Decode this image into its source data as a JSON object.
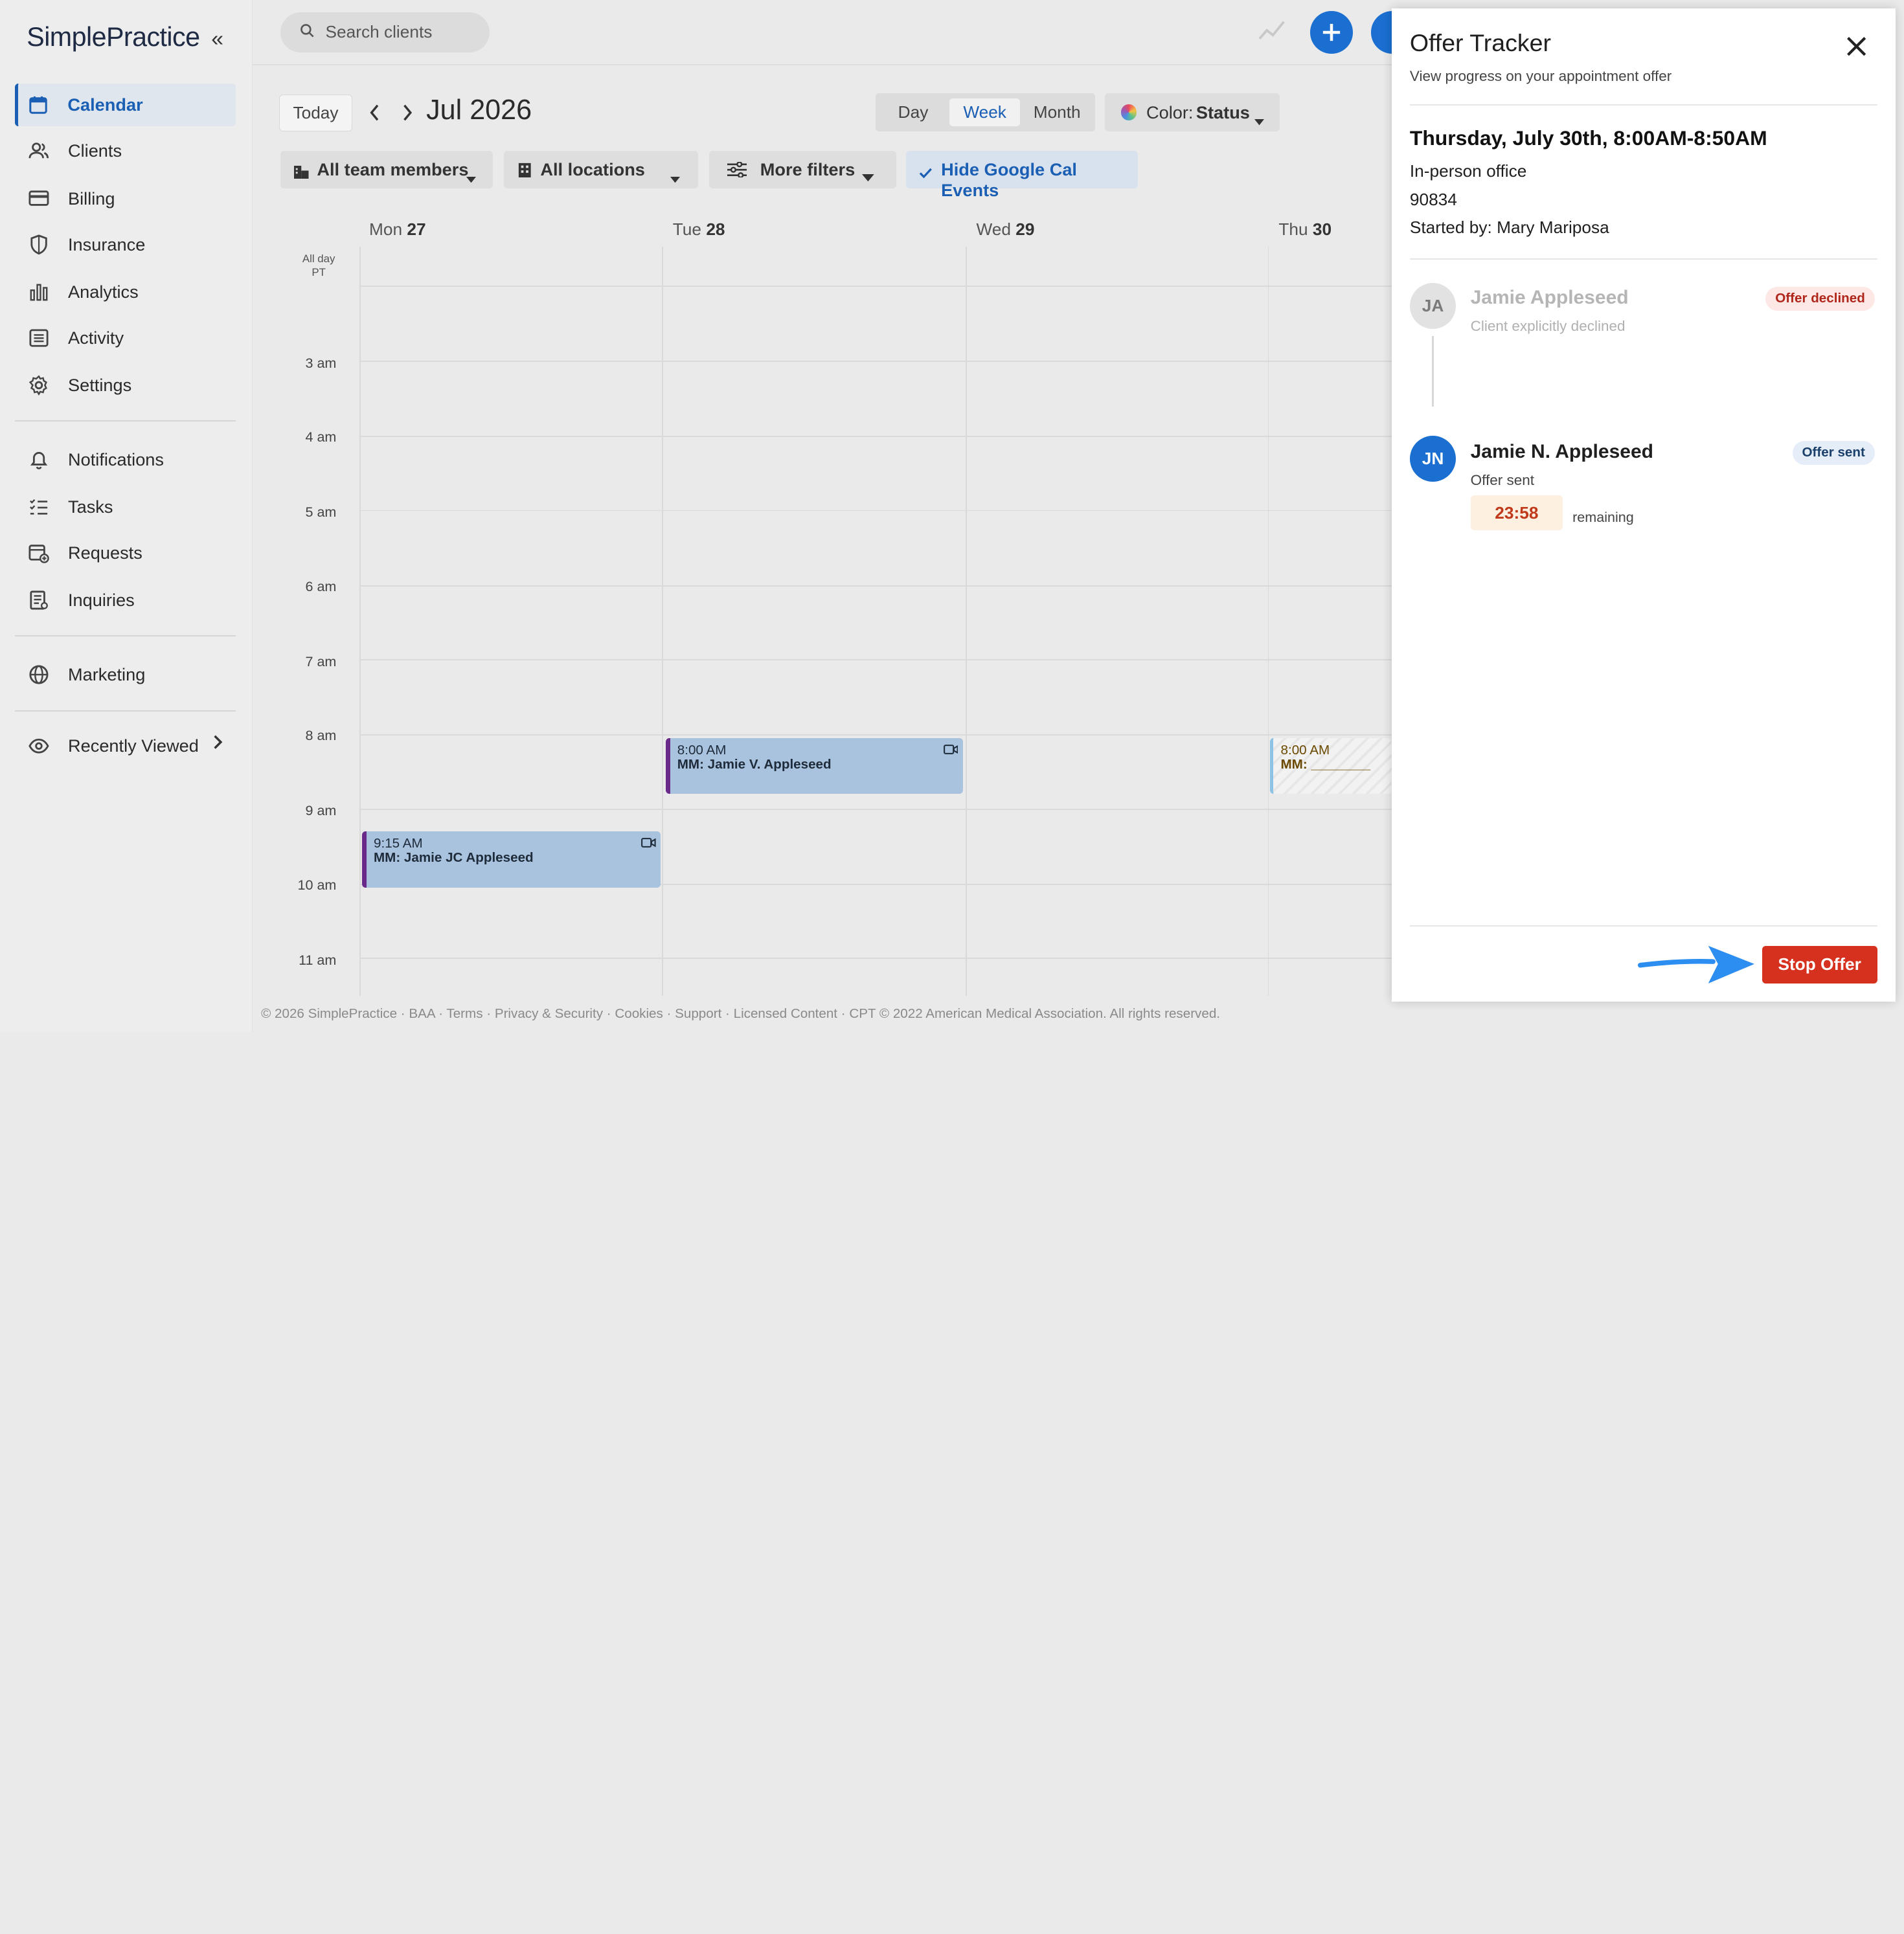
{
  "app": {
    "logo_text": "SimplePractice"
  },
  "sidebar": {
    "items": [
      {
        "label": "Calendar",
        "icon": "calendar-icon"
      },
      {
        "label": "Clients",
        "icon": "users-icon"
      },
      {
        "label": "Billing",
        "icon": "credit-card-icon"
      },
      {
        "label": "Insurance",
        "icon": "shield-icon"
      },
      {
        "label": "Analytics",
        "icon": "bar-chart-icon"
      },
      {
        "label": "Activity",
        "icon": "list-icon"
      },
      {
        "label": "Settings",
        "icon": "gear-icon"
      },
      {
        "label": "Notifications",
        "icon": "bell-icon"
      },
      {
        "label": "Tasks",
        "icon": "tasks-icon"
      },
      {
        "label": "Requests",
        "icon": "calendar-plus-icon"
      },
      {
        "label": "Inquiries",
        "icon": "clipboard-icon"
      },
      {
        "label": "Marketing",
        "icon": "globe-icon"
      },
      {
        "label": "Recently Viewed",
        "icon": "eye-icon"
      }
    ]
  },
  "search": {
    "placeholder": "Search clients"
  },
  "toolbar": {
    "today_label": "Today",
    "month_title": "Jul 2026",
    "views": [
      "Day",
      "Week",
      "Month"
    ],
    "color_label": "Color:",
    "color_value": "Status"
  },
  "filters": {
    "team": "All team members",
    "locations": "All locations",
    "more": "More filters",
    "google": "Hide Google Cal Events"
  },
  "calendar": {
    "allday_label": "All day",
    "tz_label": "PT",
    "days": [
      {
        "name": "Mon",
        "num": "27"
      },
      {
        "name": "Tue",
        "num": "28"
      },
      {
        "name": "Wed",
        "num": "29"
      },
      {
        "name": "Thu",
        "num": "30"
      }
    ],
    "hours": [
      "3 am",
      "4 am",
      "5 am",
      "6 am",
      "7 am",
      "8 am",
      "9 am",
      "10 am",
      "11 am"
    ],
    "events": [
      {
        "time": "8:00 AM",
        "title": "MM: Jamie V. Appleseed"
      },
      {
        "time": "9:15 AM",
        "title": "MM: Jamie JC Appleseed"
      },
      {
        "time": "8:00 AM",
        "title": "MM: ________"
      }
    ]
  },
  "footer": "© 2026 SimplePractice · BAA · Terms · Privacy & Security · Cookies · Support · Licensed Content · CPT © 2022 American Medical Association. All rights reserved.",
  "offer_tracker": {
    "title": "Offer Tracker",
    "subtitle": "View progress on your appointment offer",
    "appointment": "Thursday, July 30th, 8:00AM-8:50AM",
    "location": "In-person office",
    "code": "90834",
    "started_by": "Started by: Mary Mariposa",
    "clients": [
      {
        "initials": "JA",
        "name": "Jamie Appleseed",
        "status_text": "Client explicitly declined",
        "badge": "Offer declined"
      },
      {
        "initials": "JN",
        "name": "Jamie N. Appleseed",
        "status_text": "Offer sent",
        "badge": "Offer sent"
      }
    ],
    "timer": "23:58",
    "timer_suffix": "remaining",
    "stop_label": "Stop Offer"
  },
  "colors": {
    "accent": "#1a6fd1",
    "danger": "#d5311e",
    "event_fill": "#a9c2de",
    "declined_badge_bg": "#fde8e6",
    "sent_badge_bg": "#e5eef8"
  }
}
